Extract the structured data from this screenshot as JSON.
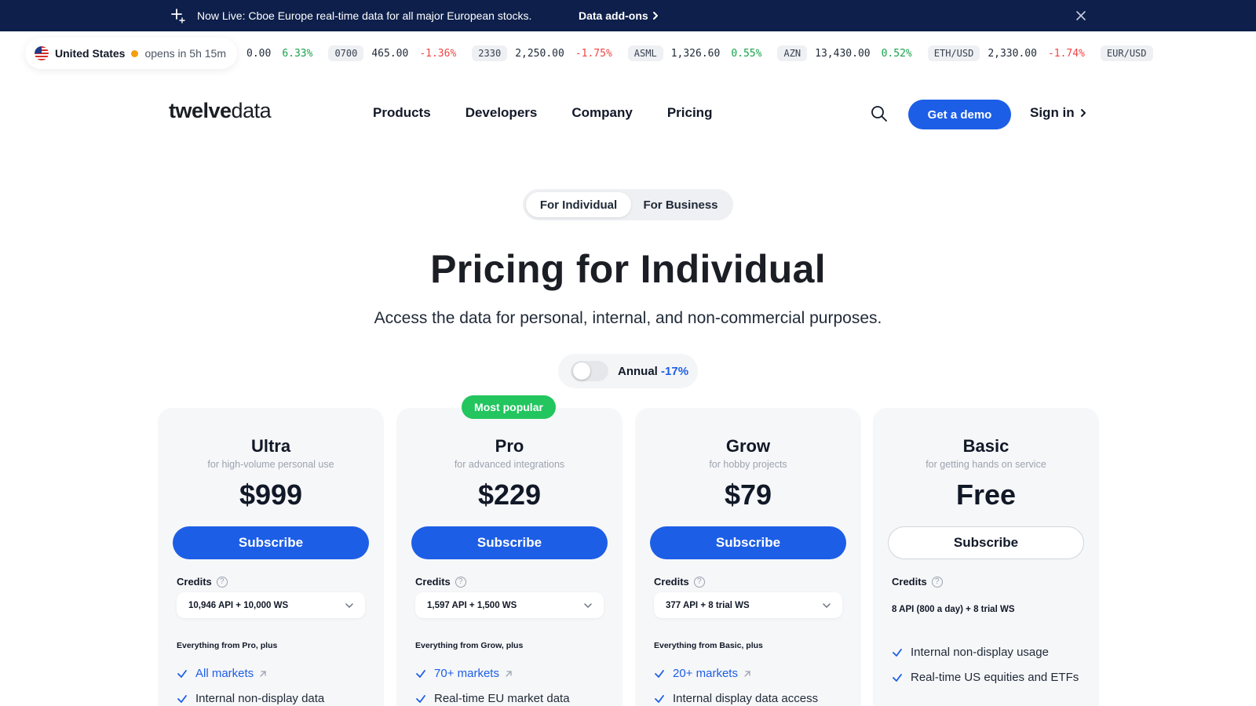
{
  "announcement": {
    "message": "Now Live: Cboe Europe real-time data for all major European stocks.",
    "link_label": "Data add-ons"
  },
  "market": {
    "country": "United States",
    "status": "opens in 5h 15m"
  },
  "ticker": [
    {
      "symbol": "",
      "price": "0.00",
      "change": "6.33%",
      "direction": "up"
    },
    {
      "symbol": "0700",
      "price": "465.00",
      "change": "-1.36%",
      "direction": "down"
    },
    {
      "symbol": "2330",
      "price": "2,250.00",
      "change": "-1.75%",
      "direction": "down"
    },
    {
      "symbol": "ASML",
      "price": "1,326.60",
      "change": "0.55%",
      "direction": "up"
    },
    {
      "symbol": "AZN",
      "price": "13,430.00",
      "change": "0.52%",
      "direction": "up"
    },
    {
      "symbol": "ETH/USD",
      "price": "2,330.00",
      "change": "-1.74%",
      "direction": "down"
    },
    {
      "symbol": "EUR/USD",
      "price": "",
      "change": "",
      "direction": "up"
    }
  ],
  "header": {
    "logo_bold": "twelve",
    "logo_light": "data",
    "nav": [
      "Products",
      "Developers",
      "Company",
      "Pricing"
    ],
    "demo_label": "Get a demo",
    "signin_label": "Sign in"
  },
  "segment": {
    "options": [
      "For Individual",
      "For Business"
    ],
    "selected": "For Individual"
  },
  "page": {
    "title": "Pricing for Individual",
    "subtitle": "Access the data for personal, internal, and non-commercial purposes."
  },
  "billing": {
    "label": "Annual",
    "discount": "-17%",
    "enabled": false
  },
  "popular_badge": "Most popular",
  "plans": [
    {
      "name": "Ultra",
      "tagline": "for high-volume personal use",
      "price": "$999",
      "cta": "Subscribe",
      "credits_label": "Credits",
      "credits_value": "10,946 API + 10,000 WS",
      "includes": "Everything from Pro, plus",
      "features": [
        {
          "text": "All markets",
          "link": true
        },
        {
          "text": "Internal non-display data",
          "link": false
        }
      ]
    },
    {
      "name": "Pro",
      "tagline": "for advanced integrations",
      "price": "$229",
      "cta": "Subscribe",
      "credits_label": "Credits",
      "credits_value": "1,597 API + 1,500 WS",
      "includes": "Everything from Grow, plus",
      "features": [
        {
          "text": "70+ markets",
          "link": true
        },
        {
          "text": "Real-time EU market data",
          "link": false
        }
      ]
    },
    {
      "name": "Grow",
      "tagline": "for hobby projects",
      "price": "$79",
      "cta": "Subscribe",
      "credits_label": "Credits",
      "credits_value": "377 API + 8 trial WS",
      "includes": "Everything from Basic, plus",
      "features": [
        {
          "text": "20+ markets",
          "link": true
        },
        {
          "text": "Internal display data access",
          "link": false
        }
      ]
    },
    {
      "name": "Basic",
      "tagline": "for getting hands on service",
      "price": "Free",
      "cta": "Subscribe",
      "credits_label": "Credits",
      "credits_value": "8 API (800 a day) + 8 trial WS",
      "includes": "",
      "features": [
        {
          "text": "Internal non-display usage",
          "link": false
        },
        {
          "text": "Real-time US equities and ETFs",
          "link": false
        }
      ]
    }
  ],
  "colors": {
    "brand_blue": "#1d5ee6",
    "announce_bg": "#0d1f4a",
    "up": "#16a34a",
    "down": "#ef4444",
    "popular": "#22c55e"
  }
}
